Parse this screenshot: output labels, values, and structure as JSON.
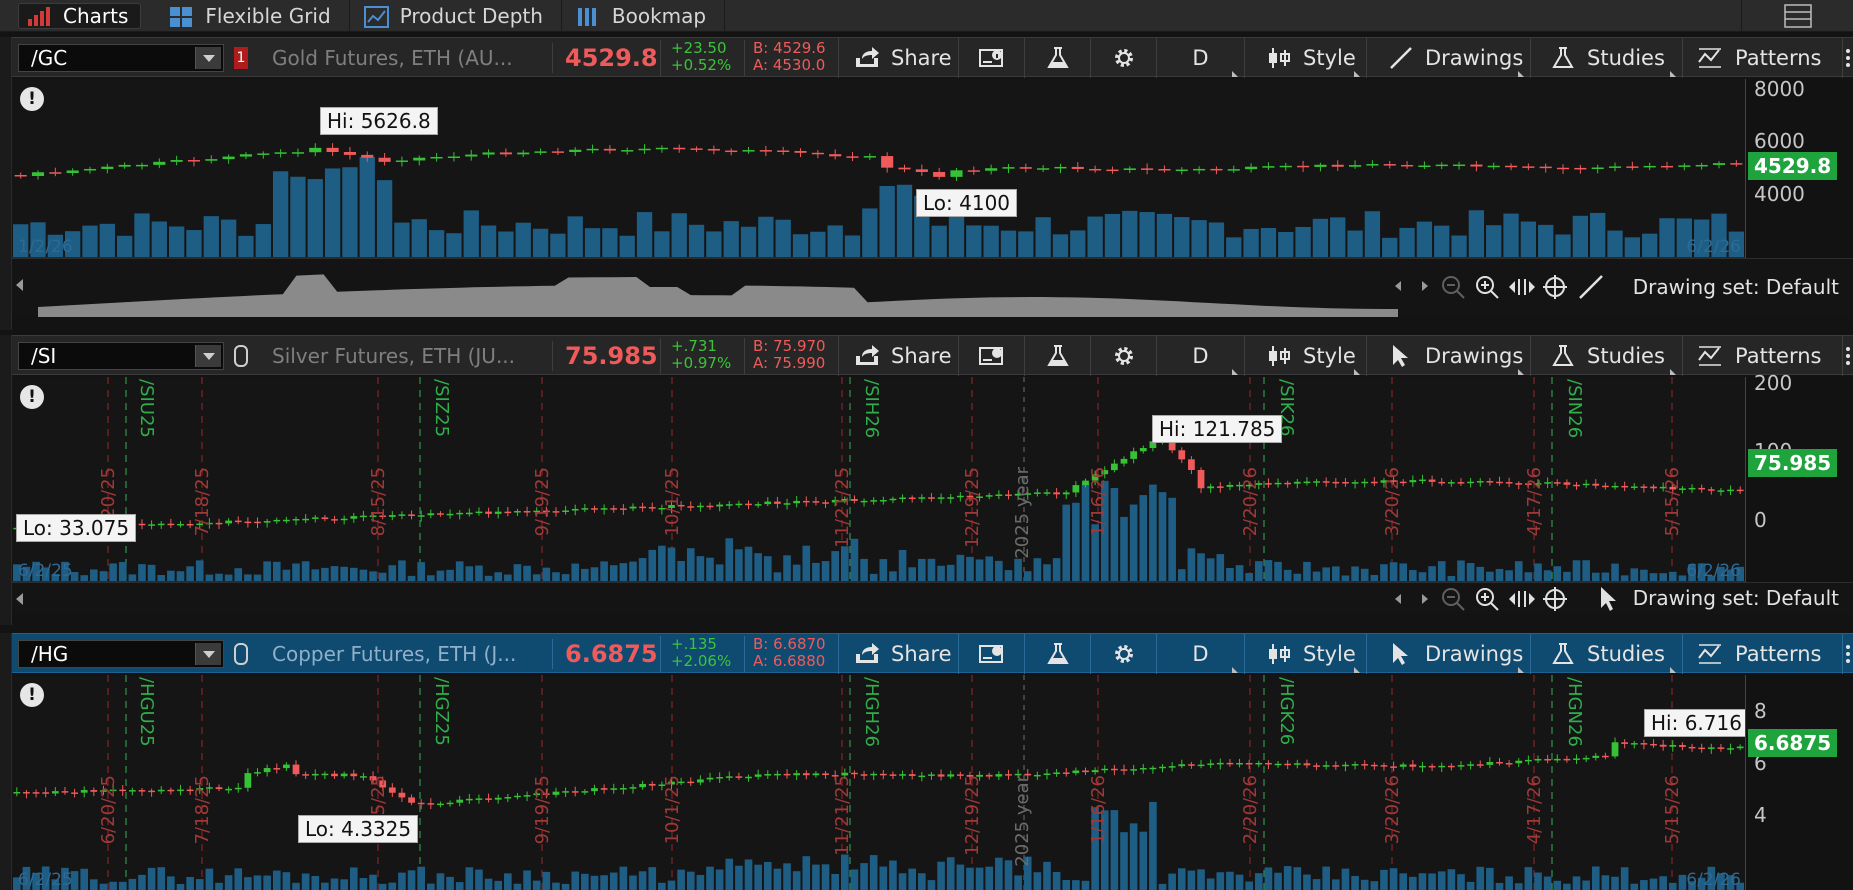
{
  "tabs": [
    {
      "label": "Charts",
      "icon": "bar-chart-icon"
    },
    {
      "label": "Flexible Grid",
      "icon": "grid-icon"
    },
    {
      "label": "Product Depth",
      "icon": "depth-chart-icon"
    },
    {
      "label": "Bookmap",
      "icon": "bookmap-icon"
    }
  ],
  "toolbar": {
    "share": "Share",
    "period": "D",
    "style": "Style",
    "drawings": "Drawings",
    "studies": "Studies",
    "patterns": "Patterns"
  },
  "nav": {
    "drawing_set": "Drawing set: Default"
  },
  "colors": {
    "up": "#35c235",
    "down": "#f05a5a",
    "volume": "#1e5d84",
    "price_tag": "#1fa33d",
    "active_header": "#0f4a70"
  },
  "panels": [
    {
      "symbol": "/GC",
      "link_badge": "1",
      "description": "Gold Futures, ETH (AU...",
      "last": "4529.8",
      "net_change": "+23.50",
      "pct_change": "+0.52%",
      "bid": "B: 4529.6",
      "ask": "A: 4530.0",
      "y_ticks": [
        "8000",
        "6000",
        "4000"
      ],
      "price_tag": "4529.8",
      "hi": "Hi: 5626.8",
      "lo": "Lo: 4100",
      "date_start": "1/2/26",
      "date_end": "6/2/26"
    },
    {
      "symbol": "/SI",
      "description": "Silver Futures, ETH (JU...",
      "last": "75.985",
      "net_change": "+.731",
      "pct_change": "+0.97%",
      "bid": "B: 75.970",
      "ask": "A: 75.990",
      "y_ticks": [
        "200",
        "100",
        "0"
      ],
      "price_tag": "75.985",
      "hi": "Hi: 121.785",
      "lo": "Lo: 33.075",
      "date_start": "6/2/25",
      "date_end": "6/2/26",
      "expirations": [
        "/SIU25",
        "/SIZ25",
        "/SIH26",
        "/SIK26",
        "/SIN26"
      ],
      "dates": [
        "6/20/25",
        "7/18/25",
        "8/15/25",
        "9/19/25",
        "10/1/25",
        "11/21/25",
        "12/19/25",
        "1/16/26",
        "2/20/26",
        "3/20/26",
        "4/17/26",
        "5/15/26"
      ],
      "year_label": "2025 year"
    },
    {
      "symbol": "/HG",
      "description": "Copper Futures, ETH (J...",
      "last": "6.6875",
      "net_change": "+.135",
      "pct_change": "+2.06%",
      "bid": "B: 6.6870",
      "ask": "A: 6.6880",
      "y_ticks": [
        "8",
        "6",
        "4"
      ],
      "price_tag": "6.6875",
      "hi": "Hi: 6.716",
      "lo": "Lo: 4.3325",
      "date_start": "6/2/25",
      "date_end": "6/2/26",
      "expirations": [
        "/HGU25",
        "/HGZ25",
        "/HGH26",
        "/HGK26",
        "/HGN26"
      ],
      "dates": [
        "6/20/25",
        "7/18/25",
        "8/15/25",
        "9/19/25",
        "10/1/25",
        "11/21/25",
        "12/19/25",
        "1/16/26",
        "2/20/26",
        "3/20/26",
        "4/17/26",
        "5/15/26"
      ],
      "year_label": "2025 year"
    }
  ]
}
